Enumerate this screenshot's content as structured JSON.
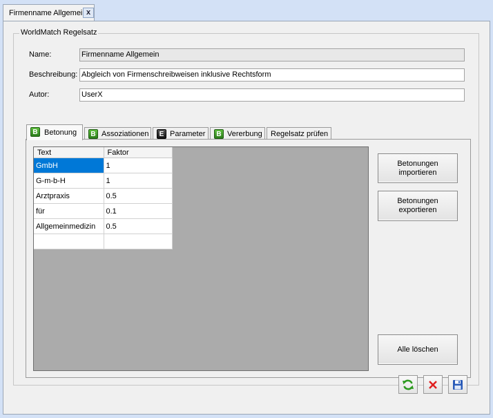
{
  "document_tab": {
    "title": "Firmenname Allgemein",
    "close_label": "x"
  },
  "group": {
    "legend": "WorldMatch Regelsatz"
  },
  "form": {
    "name_label": "Name:",
    "name_value": "Firmenname Allgemein",
    "description_label": "Beschreibung:",
    "description_value": "Abgleich von Firmenschreibweisen inklusive Rechtsform",
    "author_label": "Autor:",
    "author_value": "UserX"
  },
  "tabs": [
    {
      "badge": "B",
      "label": "Betonung",
      "active": true
    },
    {
      "badge": "B",
      "label": "Assoziationen",
      "active": false
    },
    {
      "badge": "E",
      "label": "Parameter",
      "active": false
    },
    {
      "badge": "B",
      "label": "Vererbung",
      "active": false
    },
    {
      "badge": "",
      "label": "Regelsatz prüfen",
      "active": false
    }
  ],
  "grid": {
    "columns": [
      "Text",
      "Faktor"
    ],
    "rows": [
      {
        "text": "GmbH",
        "faktor": "1"
      },
      {
        "text": "G-m-b-H",
        "faktor": "1"
      },
      {
        "text": "Arztpraxis",
        "faktor": "0.5"
      },
      {
        "text": "für",
        "faktor": "0.1"
      },
      {
        "text": "Allgemeinmedizin",
        "faktor": "0.5"
      },
      {
        "text": "",
        "faktor": ""
      }
    ]
  },
  "side_buttons": {
    "import_label": "Betonungen\nimportieren",
    "export_label": "Betonungen\nexportieren",
    "clear_label": "Alle löschen"
  },
  "footer": {
    "refresh_icon": "refresh-icon",
    "cancel_icon": "close-icon",
    "save_icon": "save-disk-icon"
  },
  "colors": {
    "selection": "#0078d7",
    "badge_green": "#3a9a24",
    "cancel_red": "#e02020",
    "save_blue": "#2a5bb8"
  }
}
